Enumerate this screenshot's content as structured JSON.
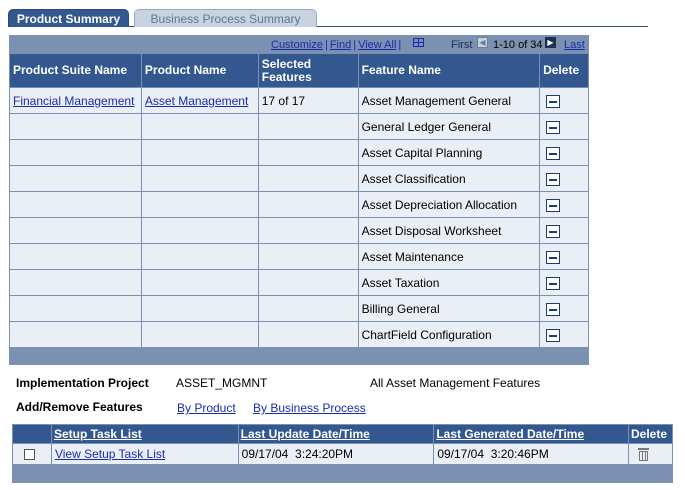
{
  "tabs": [
    {
      "label": "Product Summary",
      "active": true
    },
    {
      "label": "Business Process Summary",
      "active": false
    }
  ],
  "grid_nav": {
    "customize": "Customize",
    "find": "Find",
    "view_all": "View All",
    "first": "First",
    "range": "1-10 of 34",
    "last": "Last",
    "grid_icon": "grid-icon",
    "prev_icon": "arrow-left-icon",
    "next_icon": "arrow-right-icon"
  },
  "features_table": {
    "headers": [
      "Product Suite Name",
      "Product Name",
      "Selected Features",
      "Feature Name",
      "Delete"
    ],
    "rows": [
      {
        "suite": "Financial Management",
        "product": "Asset Management",
        "selected": "17 of 17",
        "feature": "Asset Management General"
      },
      {
        "suite": "",
        "product": "",
        "selected": "",
        "feature": "General Ledger General"
      },
      {
        "suite": "",
        "product": "",
        "selected": "",
        "feature": "Asset Capital Planning"
      },
      {
        "suite": "",
        "product": "",
        "selected": "",
        "feature": "Asset Classification"
      },
      {
        "suite": "",
        "product": "",
        "selected": "",
        "feature": "Asset Depreciation Allocation"
      },
      {
        "suite": "",
        "product": "",
        "selected": "",
        "feature": "Asset Disposal Worksheet"
      },
      {
        "suite": "",
        "product": "",
        "selected": "",
        "feature": "Asset Maintenance"
      },
      {
        "suite": "",
        "product": "",
        "selected": "",
        "feature": "Asset Taxation"
      },
      {
        "suite": "",
        "product": "",
        "selected": "",
        "feature": "Billing General"
      },
      {
        "suite": "",
        "product": "",
        "selected": "",
        "feature": "ChartField Configuration"
      }
    ]
  },
  "project": {
    "label": "Implementation Project",
    "value": "ASSET_MGMNT",
    "description": "All Asset Management Features"
  },
  "add_remove": {
    "label": "Add/Remove Features",
    "by_product": "By Product",
    "by_business_process": "By Business Process"
  },
  "setup_table": {
    "headers": [
      "Setup Task List",
      "Last Update Date/Time",
      "Last Generated Date/Time",
      "Delete"
    ],
    "rows": [
      {
        "task_link": "View Setup Task List",
        "last_update": "09/17/04  3:24:20PM",
        "last_generated": "09/17/04  3:20:46PM"
      }
    ]
  },
  "colors": {
    "header_bg": "#33578f",
    "grid_border": "#7b91b1",
    "row_bg": "#eaeff5",
    "link": "#1a2bb0"
  }
}
